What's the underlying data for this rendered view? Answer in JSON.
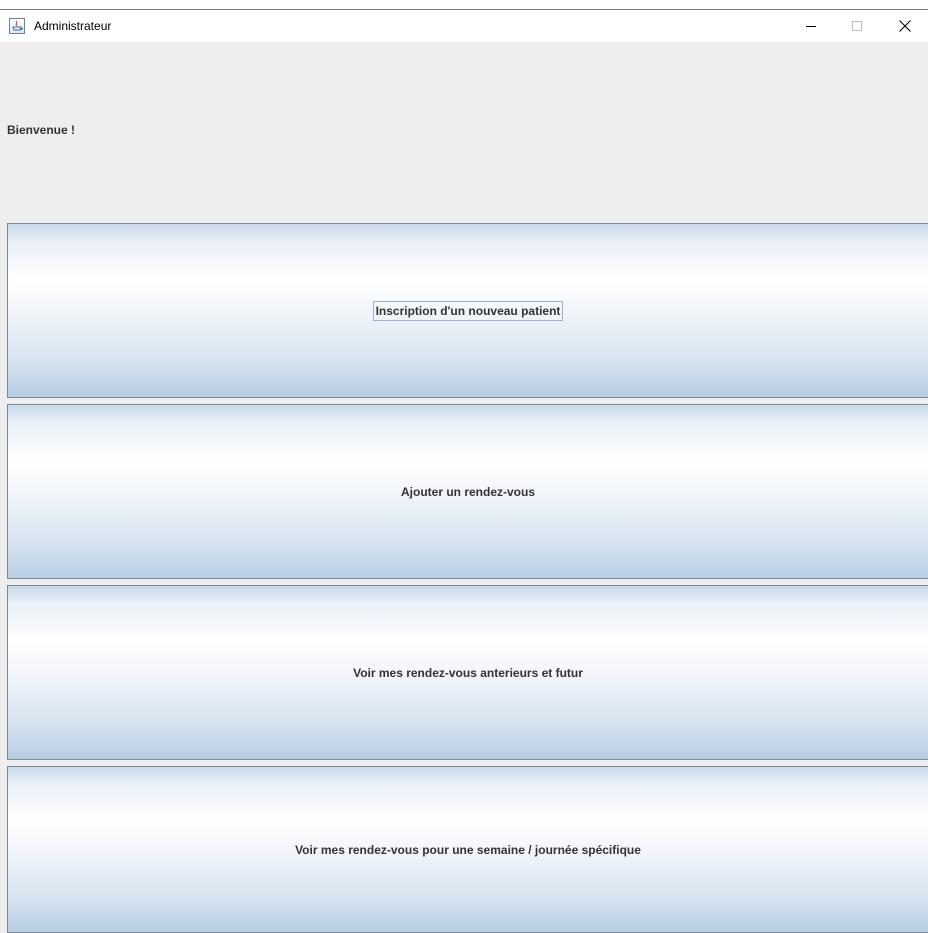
{
  "window": {
    "title": "Administrateur",
    "icon": "java-app-icon",
    "controls": [
      "minimize-icon",
      "maximize-icon",
      "close-icon"
    ]
  },
  "header": {
    "welcome": "Bienvenue !"
  },
  "actions": [
    {
      "label": "Inscription d'un nouveau patient",
      "focused": true
    },
    {
      "label": "Ajouter un rendez-vous",
      "focused": false
    },
    {
      "label": "Voir mes rendez-vous anterieurs et futur",
      "focused": false
    },
    {
      "label": "Voir mes rendez-vous pour une semaine / journée spécifique",
      "focused": false
    }
  ],
  "colors": {
    "content_background": "#eeeeee",
    "button_gradient_top": "#ffffff",
    "button_gradient_bottom": "#b8cee4",
    "button_border": "#7a8a99",
    "label_text": "#333333"
  }
}
